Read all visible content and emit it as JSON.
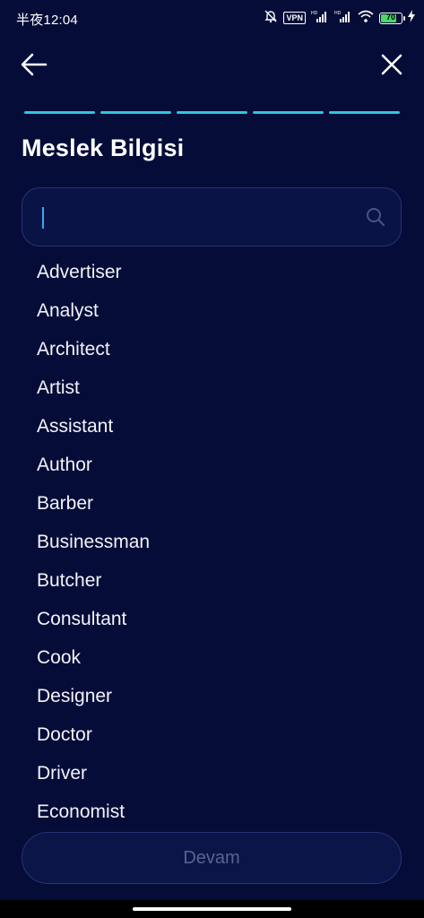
{
  "status_bar": {
    "time": "半夜12:04",
    "vpn": "VPN",
    "battery": "70",
    "icons": [
      "bell-muted-icon",
      "vpn-icon",
      "signal-hd-icon",
      "signal-hd-icon",
      "wifi-icon",
      "battery-icon",
      "charging-bolt-icon"
    ]
  },
  "header": {
    "back_icon": "arrow-left-icon",
    "close_icon": "close-icon"
  },
  "progress": {
    "steps": 5,
    "completed": 5,
    "color": "#2fc6dc"
  },
  "page_title": "Meslek Bilgisi",
  "search": {
    "value": "",
    "placeholder": "",
    "icon": "search-icon"
  },
  "occupations": [
    "Advertiser",
    "Analyst",
    "Architect",
    "Artist",
    "Assistant",
    "Author",
    "Barber",
    "Businessman",
    "Butcher",
    "Consultant",
    "Cook",
    "Designer",
    "Doctor",
    "Driver",
    "Economist"
  ],
  "continue_label": "Devam",
  "colors": {
    "background": "#050c38",
    "accent": "#2fc6dc",
    "caret": "#33a9ee",
    "disabled_text": "#5b6490"
  }
}
